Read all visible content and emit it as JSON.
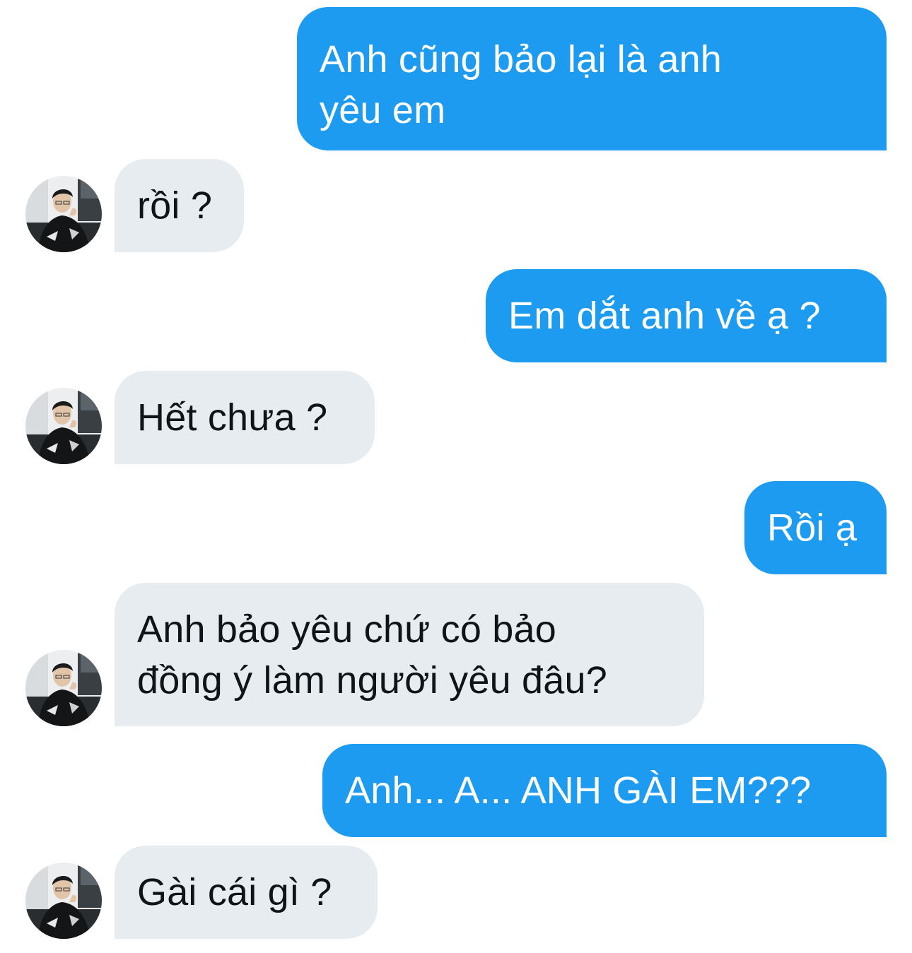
{
  "conversation": {
    "messages": [
      {
        "sender": "me",
        "lines": [
          "Anh cũng bảo lại là anh",
          "yêu em"
        ]
      },
      {
        "sender": "them",
        "lines": [
          "rồi ?"
        ]
      },
      {
        "sender": "me",
        "lines": [
          "Em dắt anh về ạ ?"
        ]
      },
      {
        "sender": "them",
        "lines": [
          "Hết chưa ?"
        ]
      },
      {
        "sender": "me",
        "lines": [
          "Rồi ạ"
        ]
      },
      {
        "sender": "them",
        "lines": [
          "Anh bảo yêu chứ có bảo",
          "đồng ý làm người yêu đâu?"
        ]
      },
      {
        "sender": "me",
        "lines": [
          "Anh... A... ANH GÀI EM???"
        ]
      },
      {
        "sender": "them",
        "lines": [
          "Gài cái gì ?"
        ]
      }
    ],
    "contact_avatar_icon": "user-avatar-photo",
    "colors": {
      "sent_bubble": "#1d9bf0",
      "received_bubble": "#e7ecf0",
      "sent_text": "#ffffff",
      "received_text": "#0f1419"
    }
  }
}
